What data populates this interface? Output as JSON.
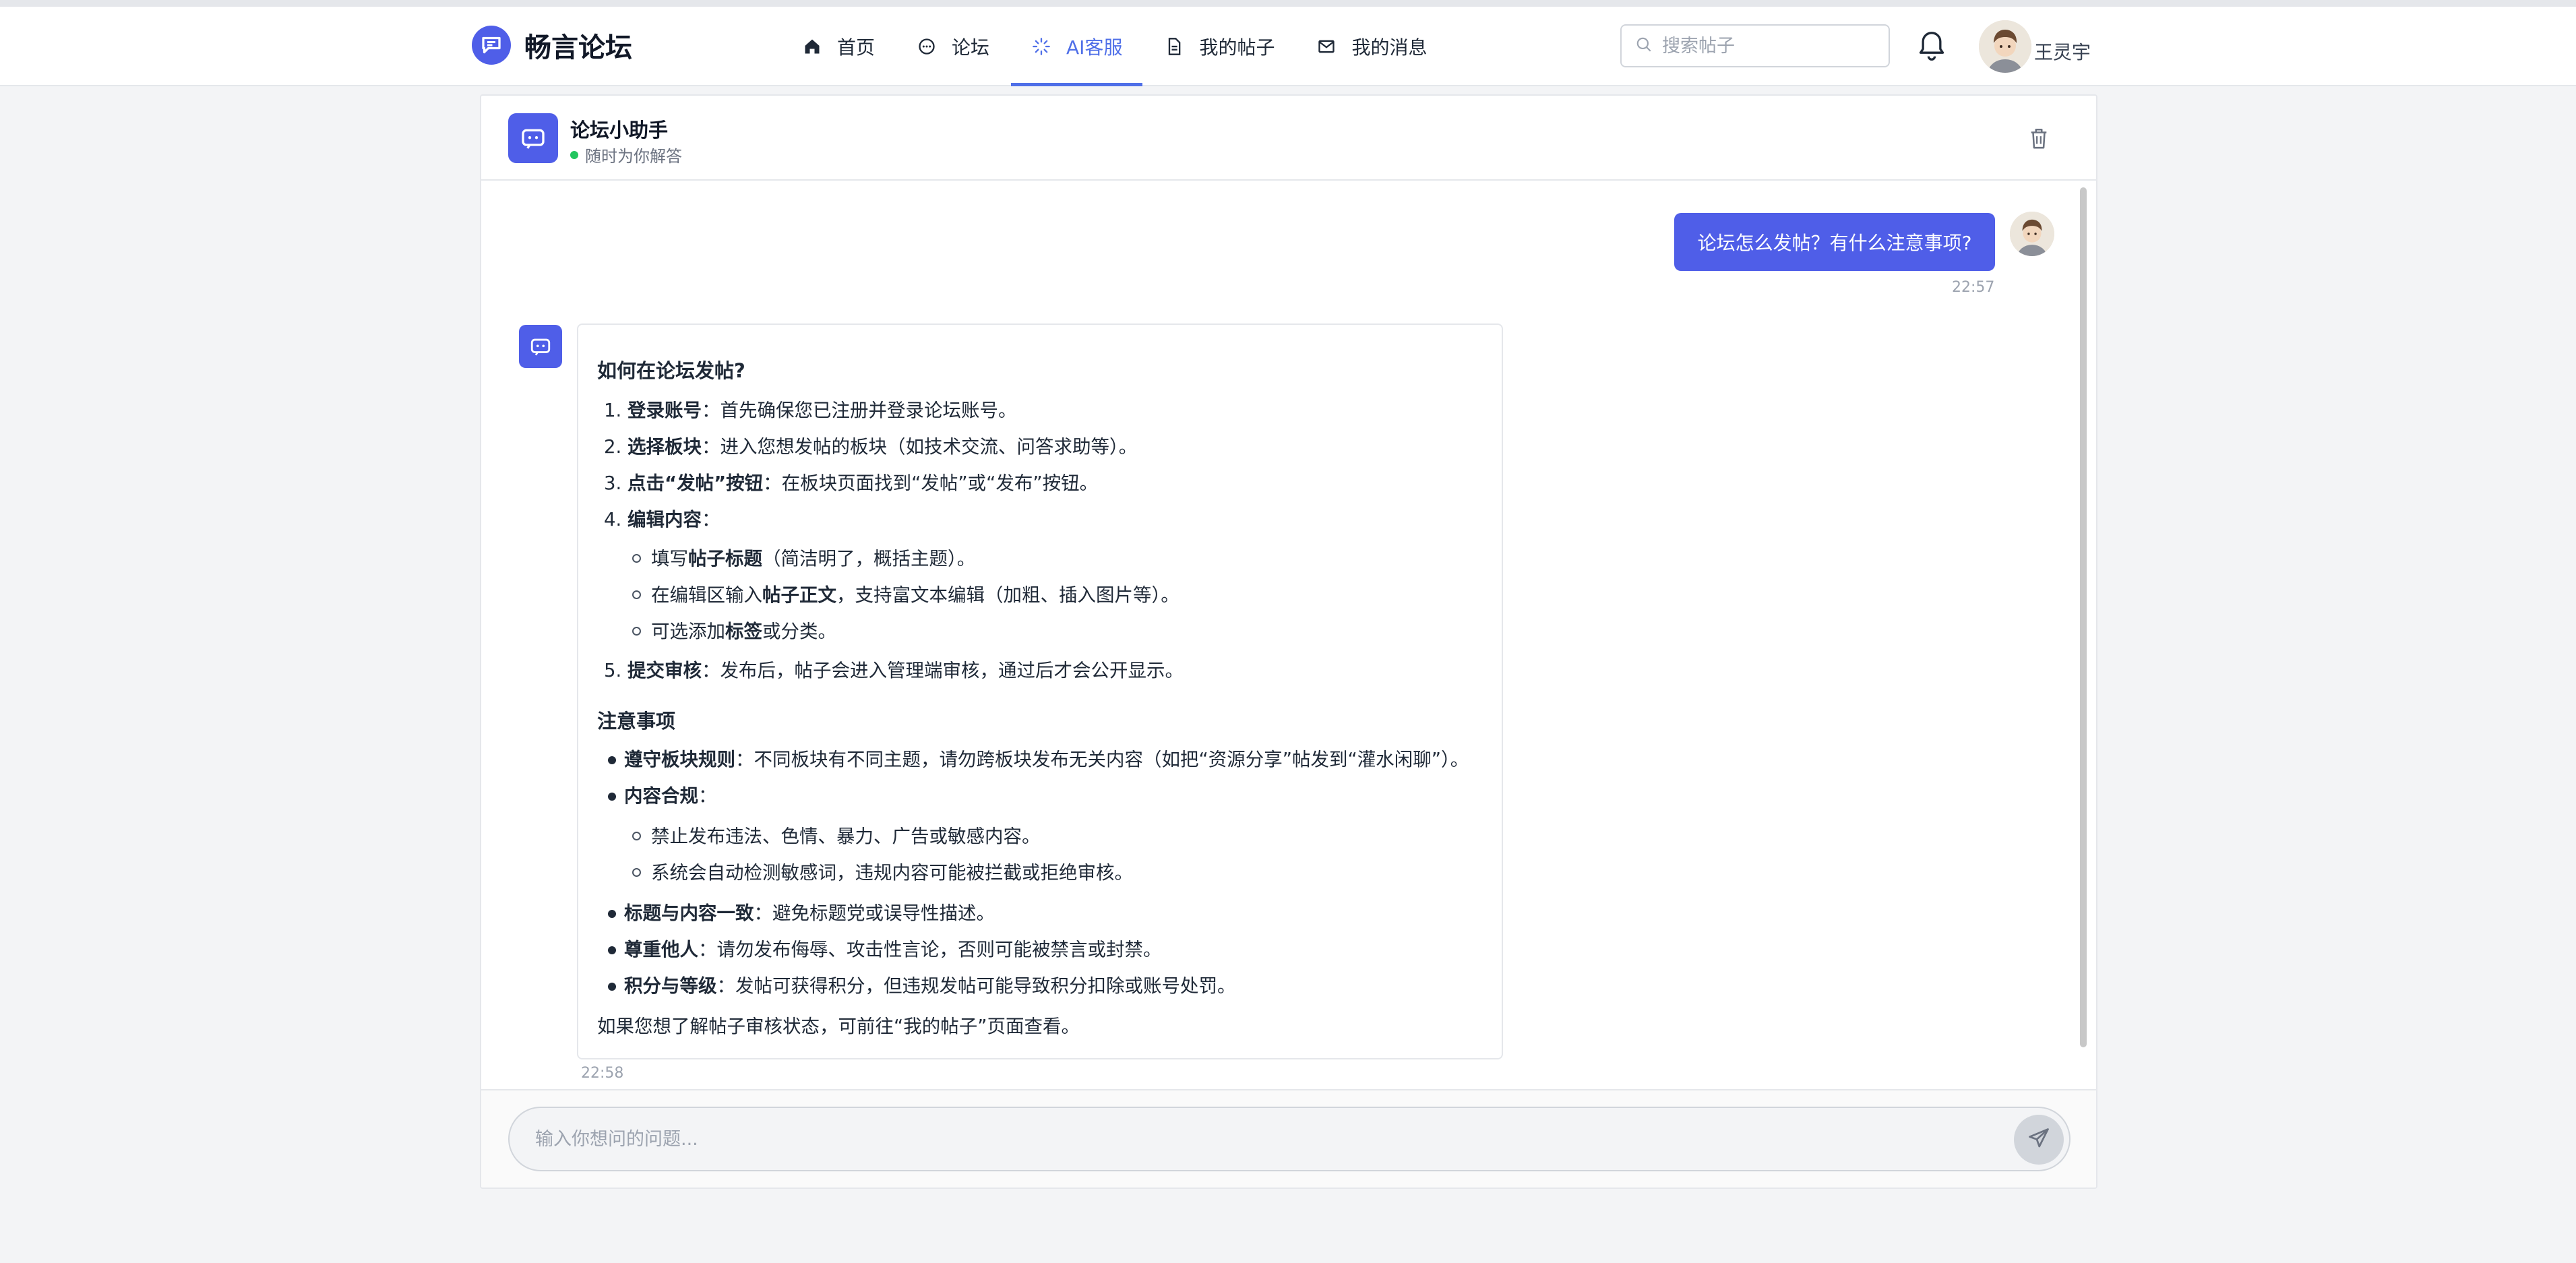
{
  "header": {
    "brand": "畅言论坛",
    "nav": [
      {
        "label": "首页",
        "icon": "home-icon"
      },
      {
        "label": "论坛",
        "icon": "chat-icon"
      },
      {
        "label": "AI客服",
        "icon": "sparkle-icon",
        "active": true
      },
      {
        "label": "我的帖子",
        "icon": "document-icon"
      },
      {
        "label": "我的消息",
        "icon": "mail-icon"
      }
    ],
    "search_placeholder": "搜索帖子",
    "user_name": "王灵宇"
  },
  "chat": {
    "bot_name": "论坛小助手",
    "bot_status": "随时为你解答",
    "user_message": "论坛怎么发帖？有什么注意事项?",
    "user_time": "22:57",
    "bot_time": "22:58",
    "reply": {
      "heading1": "如何在论坛发帖?",
      "steps": [
        {
          "num": "1.",
          "bold": "登录账号",
          "text": "：首先确保您已注册并登录论坛账号。"
        },
        {
          "num": "2.",
          "bold": "选择板块",
          "text": "：进入您想发帖的板块（如技术交流、问答求助等）。"
        },
        {
          "num": "3.",
          "bold": "点击“发帖”按钮",
          "text": "：在板块页面找到“发帖”或“发布”按钮。"
        },
        {
          "num": "4.",
          "bold": "编辑内容",
          "text": "："
        },
        {
          "num": "5.",
          "bold": "提交审核",
          "text": "：发布后，帖子会进入管理端审核，通过后才会公开显示。"
        }
      ],
      "edit_sub": [
        {
          "pre": "填写",
          "bold": "帖子标题",
          "post": "（简洁明了，概括主题）。"
        },
        {
          "pre": "在编辑区输入",
          "bold": "帖子正文",
          "post": "，支持富文本编辑（加粗、插入图片等）。"
        },
        {
          "pre": "可选添加",
          "bold": "标签",
          "post": "或分类。"
        }
      ],
      "heading2": "注意事项",
      "notes": [
        {
          "bold": "遵守板块规则",
          "text": "：不同板块有不同主题，请勿跨板块发布无关内容（如把“资源分享”帖发到“灌水闲聊”）。"
        },
        {
          "bold": "内容合规",
          "text": "："
        },
        {
          "bold": "标题与内容一致",
          "text": "：避免标题党或误导性描述。"
        },
        {
          "bold": "尊重他人",
          "text": "：请勿发布侮辱、攻击性言论，否则可能被禁言或封禁。"
        },
        {
          "bold": "积分与等级",
          "text": "：发帖可获得积分，但违规发帖可能导致积分扣除或账号处罚。"
        }
      ],
      "compliance_sub": [
        "禁止发布违法、色情、暴力、广告或敏感内容。",
        "系统会自动检测敏感词，违规内容可能被拦截或拒绝审核。"
      ],
      "footer": "如果您想了解帖子审核状态，可前往“我的帖子”页面查看。"
    },
    "input_placeholder": "输入你想问的问题..."
  },
  "colors": {
    "accent": "#4f5ee8",
    "active_nav": "#4f6fe8",
    "status_online": "#22c55e"
  }
}
